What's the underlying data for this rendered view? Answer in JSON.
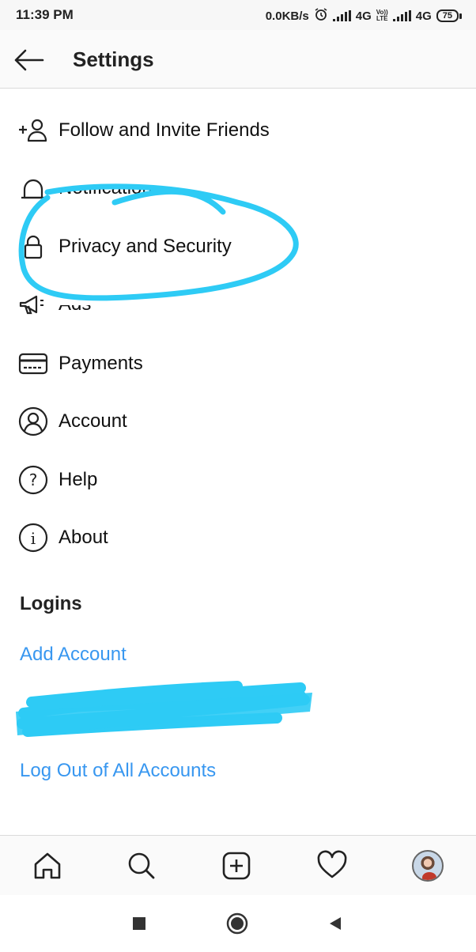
{
  "status_bar": {
    "time": "11:39 PM",
    "speed": "0.0KB/s",
    "alarm_icon": "alarm-clock-icon",
    "network1": "4G",
    "volte_top": "Vo))",
    "volte_bottom": "LTE",
    "network2": "4G",
    "battery": "75"
  },
  "header": {
    "back_icon": "arrow-left-icon",
    "title": "Settings"
  },
  "menu": {
    "items": [
      {
        "label": "Follow and Invite Friends",
        "icon": "add-person-icon"
      },
      {
        "label": "Notifications",
        "icon": "bell-icon"
      },
      {
        "label": "Privacy and Security",
        "icon": "lock-icon"
      },
      {
        "label": "Ads",
        "icon": "megaphone-icon"
      },
      {
        "label": "Payments",
        "icon": "credit-card-icon"
      },
      {
        "label": "Account",
        "icon": "account-circle-icon"
      },
      {
        "label": "Help",
        "icon": "help-circle-icon"
      },
      {
        "label": "About",
        "icon": "info-circle-icon"
      }
    ]
  },
  "logins": {
    "title": "Logins",
    "add_account": "Add Account",
    "logout_all": "Log Out of All Accounts"
  },
  "annotation": {
    "color": "#2ecbf5"
  },
  "bottom_nav": {
    "items": [
      "home-icon",
      "search-icon",
      "new-post-icon",
      "heart-icon",
      "profile-avatar"
    ]
  },
  "system_nav": {
    "items": [
      "recents-square-icon",
      "home-circle-icon",
      "back-triangle-icon"
    ]
  },
  "colors": {
    "link": "#3897f0",
    "text": "#111111",
    "divider": "#dbdbdb"
  }
}
